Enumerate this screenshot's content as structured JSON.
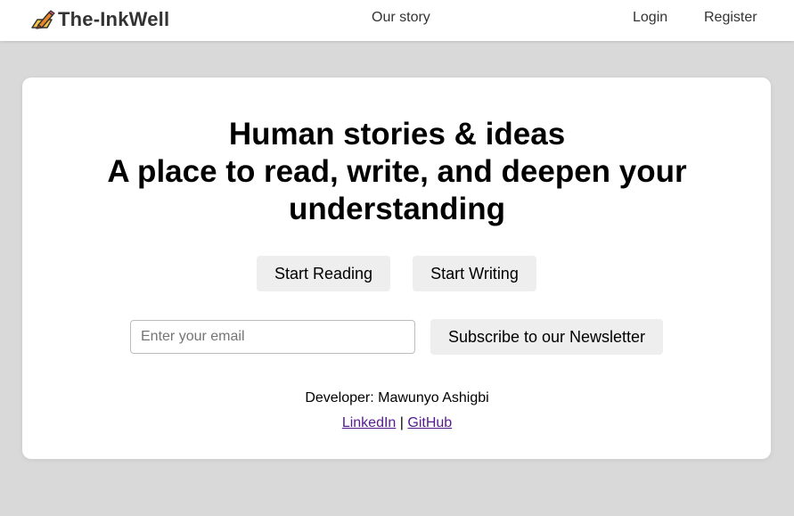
{
  "nav": {
    "brand": "The-InkWell",
    "our_story": "Our story",
    "login": "Login",
    "register": "Register"
  },
  "hero": {
    "line1": "Human stories & ideas",
    "line2": "A place to read, write, and deepen your understanding"
  },
  "actions": {
    "start_reading": "Start Reading",
    "start_writing": "Start Writing"
  },
  "newsletter": {
    "email_placeholder": "Enter your email",
    "subscribe": "Subscribe to our Newsletter"
  },
  "footer": {
    "developer": "Developer: Mawunyo Ashigbi",
    "linkedin": "LinkedIn",
    "separator": "|",
    "github": "GitHub"
  },
  "colors": {
    "page_bg": "#d9d9d9",
    "button_bg": "#eeeeee",
    "link": "#551a8b"
  },
  "icons": {
    "brand": "pencil-on-paper-icon"
  }
}
